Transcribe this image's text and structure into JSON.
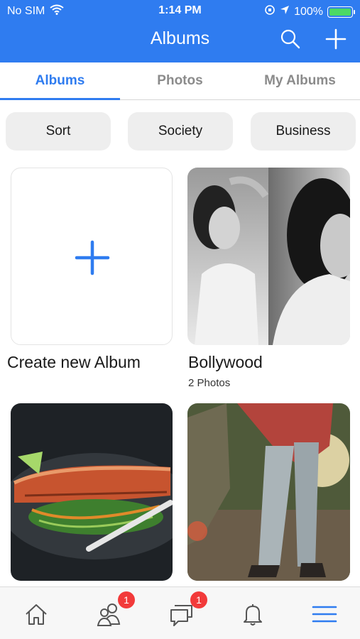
{
  "status_bar": {
    "carrier": "No SIM",
    "time": "1:14 PM",
    "battery": "100%"
  },
  "nav": {
    "title": "Albums"
  },
  "tabs": [
    {
      "label": "Albums",
      "active": true
    },
    {
      "label": "Photos",
      "active": false
    },
    {
      "label": "My Albums",
      "active": false
    }
  ],
  "filters": [
    "Sort",
    "Society",
    "Business"
  ],
  "albums": [
    {
      "title": "Create new Album"
    },
    {
      "title": "Bollywood",
      "count": "2 Photos"
    }
  ],
  "bottom_nav": {
    "items": [
      "home-icon",
      "friends-icon",
      "chat-icon",
      "bell-icon",
      "menu-icon"
    ],
    "friends_badge": "1",
    "chat_badge": "1"
  },
  "colors": {
    "accent": "#2f7cf0",
    "badge": "#f23a3a",
    "battery": "#4cd964"
  }
}
